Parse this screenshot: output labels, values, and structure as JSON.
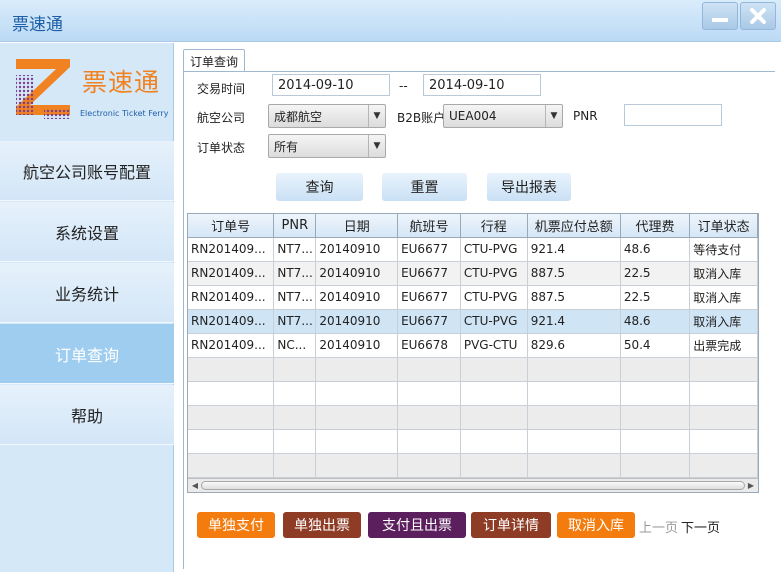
{
  "window": {
    "title": "票速通"
  },
  "logo": {
    "name": "票速通",
    "tagline": "Electronic Ticket Ferry"
  },
  "sidebar": {
    "items": [
      {
        "label": "航空公司账号配置"
      },
      {
        "label": "系统设置"
      },
      {
        "label": "业务统计"
      },
      {
        "label": "订单查询"
      },
      {
        "label": "帮助"
      }
    ],
    "active_index": 3
  },
  "tab": {
    "label": "订单查询"
  },
  "form": {
    "trade_time_label": "交易时间",
    "start_date": "2014-09-10",
    "range_sep": "--",
    "end_date": "2014-09-10",
    "airline_label": "航空公司",
    "airline_value": "成都航空",
    "b2b_label": "B2B账户",
    "b2b_value": "UEA004",
    "pnr_label": "PNR",
    "pnr_value": "",
    "status_label": "订单状态",
    "status_value": "所有"
  },
  "buttons": {
    "query": "查询",
    "reset": "重置",
    "export": "导出报表"
  },
  "table": {
    "columns": [
      "订单号",
      "PNR",
      "日期",
      "航班号",
      "行程",
      "机票应付总额",
      "代理费",
      "订单状态"
    ],
    "rows": [
      [
        "RN201409...",
        "NT7...",
        "20140910",
        "EU6677",
        "CTU-PVG",
        "921.4",
        "48.6",
        "等待支付"
      ],
      [
        "RN201409...",
        "NT7...",
        "20140910",
        "EU6677",
        "CTU-PVG",
        "887.5",
        "22.5",
        "取消入库"
      ],
      [
        "RN201409...",
        "NT7...",
        "20140910",
        "EU6677",
        "CTU-PVG",
        "887.5",
        "22.5",
        "取消入库"
      ],
      [
        "RN201409...",
        "NT7...",
        "20140910",
        "EU6677",
        "CTU-PVG",
        "921.4",
        "48.6",
        "取消入库"
      ],
      [
        "RN201409...",
        "NC...",
        "20140910",
        "EU6678",
        "PVG-CTU",
        "829.6",
        "50.4",
        "出票完成"
      ]
    ],
    "selected_row": 3
  },
  "actions": {
    "pay_only": "单独支付",
    "issue_only": "单独出票",
    "pay_and_issue": "支付且出票",
    "order_detail": "订单详情",
    "cancel_store": "取消入库",
    "prev_page": "上一页",
    "next_page": "下一页"
  },
  "colors": {
    "orange": "#f47c0e",
    "purple": "#5c1f5e",
    "brown": "#8e3c26",
    "accent": "#1f5fa8"
  }
}
